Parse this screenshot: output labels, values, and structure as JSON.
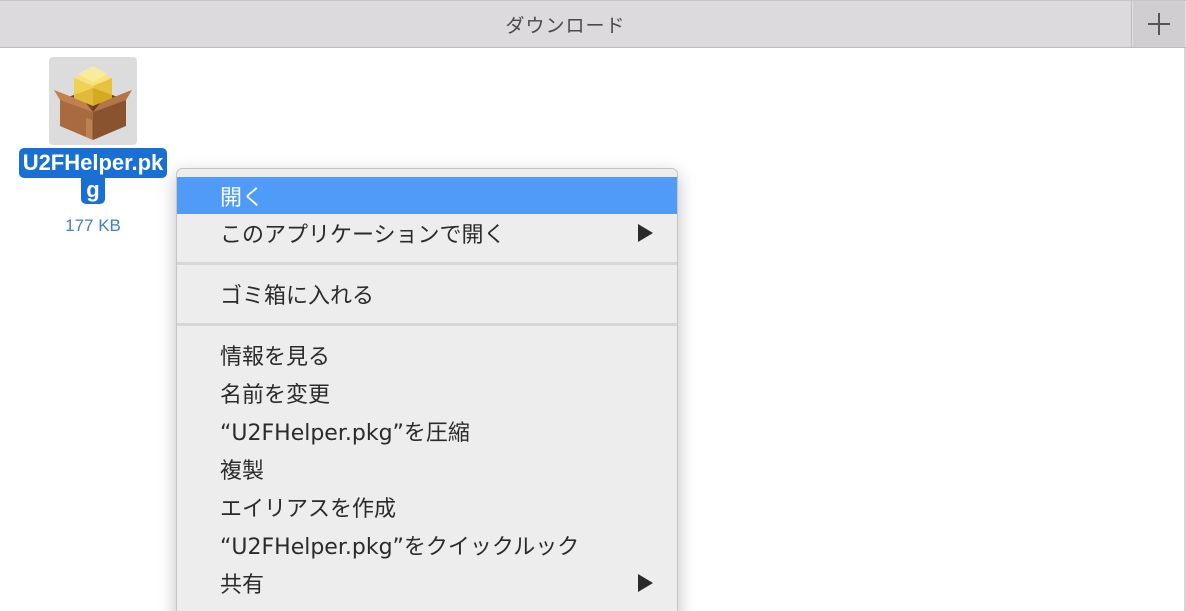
{
  "window": {
    "tab_title": "ダウンロード",
    "new_tab_icon": "plus-icon"
  },
  "file": {
    "name_line1": "U2FHelper.pk",
    "name_line2": "g",
    "size": "177 KB",
    "icon": "package-icon",
    "selection_color": "#1a6fd3"
  },
  "context_menu": {
    "highlight_color": "#4f9bf7",
    "items": [
      {
        "label": "開く",
        "highlighted": true
      },
      {
        "label": "このアプリケーションで開く",
        "submenu": true
      },
      {
        "label": "ゴミ箱に入れる"
      },
      {
        "label": "情報を見る"
      },
      {
        "label": "名前を変更"
      },
      {
        "label": "“U2FHelper.pkg”を圧縮"
      },
      {
        "label": "複製"
      },
      {
        "label": "エイリアスを作成"
      },
      {
        "label": "“U2FHelper.pkg”をクイックルック"
      },
      {
        "label": "共有",
        "submenu": true
      }
    ]
  }
}
